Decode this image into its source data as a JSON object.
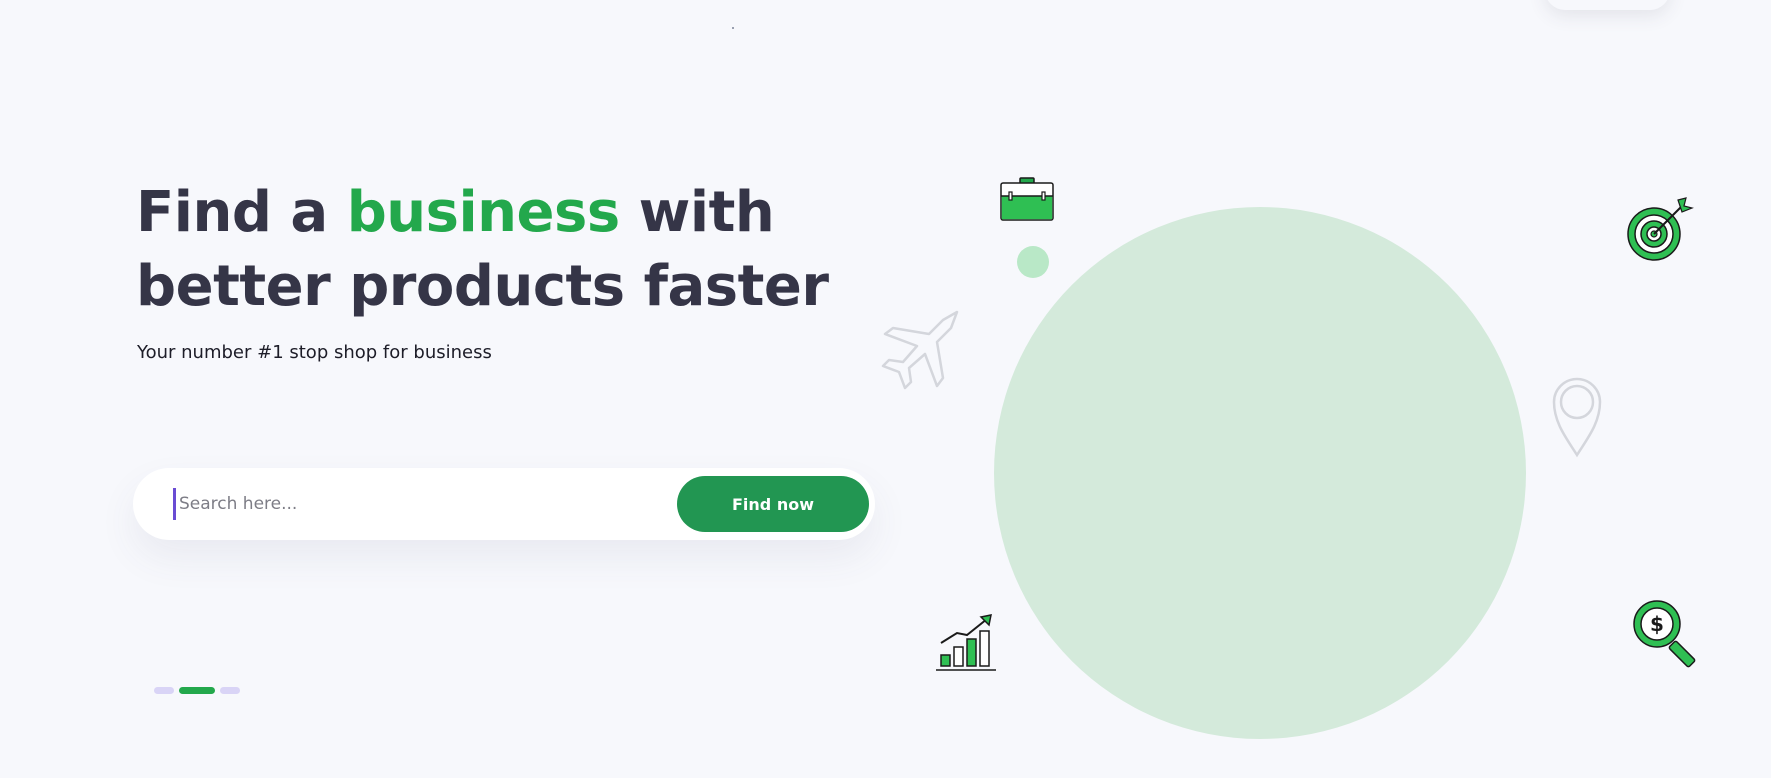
{
  "hero": {
    "title_part1": "Find a ",
    "title_accent": "business",
    "title_part2": " with better products faster",
    "subtitle": "Your number #1 stop shop for business"
  },
  "search": {
    "placeholder": "Search here...",
    "button_label": "Find now"
  },
  "slider": {
    "active_index": 1,
    "count": 3
  },
  "colors": {
    "accent": "#23a84c",
    "button": "#229652",
    "title": "#353547",
    "circle": "#d4eadb",
    "background": "#f7f8fc"
  },
  "icons": [
    "briefcase-icon",
    "target-icon",
    "airplane-icon",
    "location-pin-icon",
    "growth-chart-icon",
    "dollar-search-icon"
  ]
}
